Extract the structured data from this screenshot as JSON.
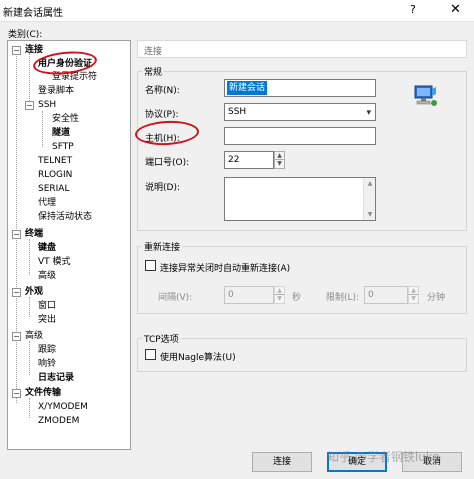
{
  "window": {
    "title": "新建会话属性",
    "help_glyph": "?",
    "close_glyph": "✕"
  },
  "category_label": "类别(C):",
  "tree": {
    "connection": "连接",
    "user_auth": "用户身份验证",
    "login_prompt": "登录提示符",
    "login_script": "登录脚本",
    "ssh": "SSH",
    "security": "安全性",
    "tunnel": "隧道",
    "sftp": "SFTP",
    "telnet": "TELNET",
    "rlogin": "RLOGIN",
    "serial": "SERIAL",
    "proxy": "代理",
    "keepalive": "保持活动状态",
    "terminal": "终端",
    "keyboard": "键盘",
    "vt_mode": "VT 模式",
    "advanced": "高级",
    "appearance": "外观",
    "window": "窗口",
    "highlight": "突出",
    "advanced2": "高级",
    "trace": "跟踪",
    "bell": "响铃",
    "logging": "日志记录",
    "file_transfer": "文件传输",
    "xymodem": "X/YMODEM",
    "zmodem": "ZMODEM",
    "expander_minus": "−"
  },
  "header": {
    "text": "连接"
  },
  "general": {
    "title": "常规",
    "name_label": "名称(N):",
    "name_value": "新建会话",
    "protocol_label": "协议(P):",
    "protocol_value": "SSH",
    "host_label": "主机(H):",
    "host_value": "",
    "port_label": "端口号(O):",
    "port_value": "22",
    "desc_label": "说明(D):",
    "desc_value": ""
  },
  "reconnect": {
    "title": "重新连接",
    "auto_label": "连接异常关闭时自动重新连接(A)",
    "interval_label": "间隔(V):",
    "interval_value": "0",
    "seconds_unit": "秒",
    "limit_label": "限制(L):",
    "limit_value": "0",
    "minutes_unit": "分钟"
  },
  "tcp": {
    "title": "TCP选项",
    "nagle_label": "使用Nagle算法(U)"
  },
  "buttons": {
    "connect": "连接",
    "ok": "确定",
    "cancel": "取消"
  },
  "watermark": "知乎 @学者钢铁luke",
  "glyphs": {
    "up": "▲",
    "down": "▼",
    "combo": "▾"
  },
  "colors": {
    "selection": "#0078d7",
    "annotation_red": "#d0121b"
  }
}
